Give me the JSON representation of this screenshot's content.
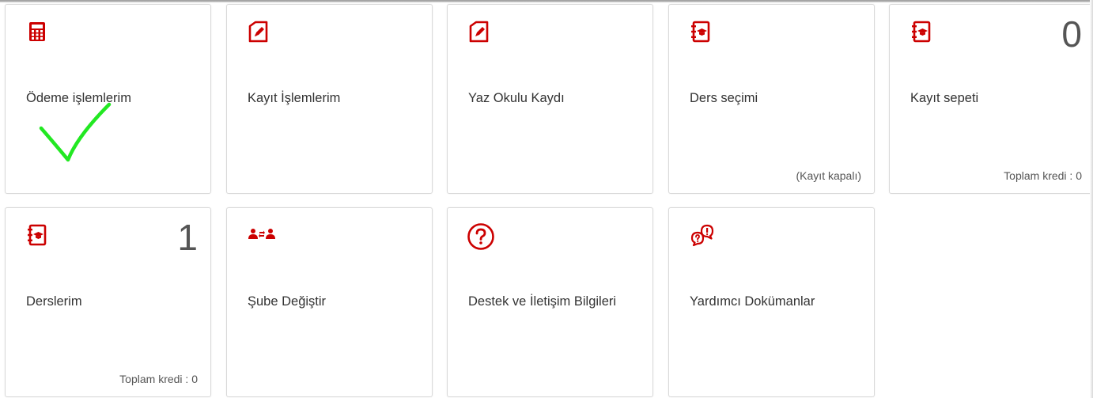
{
  "colors": {
    "accent": "#cc0000",
    "check": "#22e822"
  },
  "tiles": [
    {
      "title": "Ödeme işlemlerim",
      "icon": "calculator-icon"
    },
    {
      "title": "Kayıt İşlemlerim",
      "icon": "edit-document-icon"
    },
    {
      "title": "Yaz Okulu Kaydı",
      "icon": "edit-document-icon"
    },
    {
      "title": "Ders seçimi",
      "icon": "course-book-icon",
      "footer": "(Kayıt kapalı)"
    },
    {
      "title": "Kayıt sepeti",
      "icon": "course-book-icon",
      "count": "0",
      "footer": "Toplam kredi : 0"
    },
    {
      "title": "Derslerim",
      "icon": "course-book-icon",
      "count": "1",
      "footer": "Toplam kredi : 0"
    },
    {
      "title": "Şube Değiştir",
      "icon": "swap-users-icon"
    },
    {
      "title": "Destek ve İletişim Bilgileri",
      "icon": "question-circle-icon"
    },
    {
      "title": "Yardımcı Dokümanlar",
      "icon": "help-bubbles-icon"
    }
  ]
}
